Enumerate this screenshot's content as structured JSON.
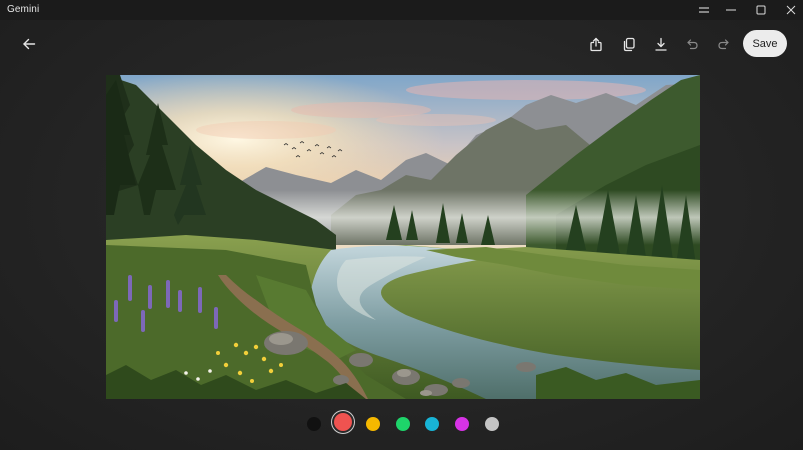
{
  "window": {
    "title": "Gemini"
  },
  "toolbar": {
    "save_label": "Save",
    "icons": [
      "back-arrow-icon",
      "share-icon",
      "copy-icon",
      "download-icon",
      "undo-icon",
      "redo-icon"
    ]
  },
  "palette": {
    "colors": [
      "#111111",
      "#ef5350",
      "#f5b800",
      "#1ed46a",
      "#18b4d6",
      "#d733e6",
      "#c4c4c4"
    ],
    "selected_index": 1
  },
  "colors": {
    "background": "#262626",
    "titlebar": "#1b1b1b",
    "save_button": "#ececec"
  }
}
